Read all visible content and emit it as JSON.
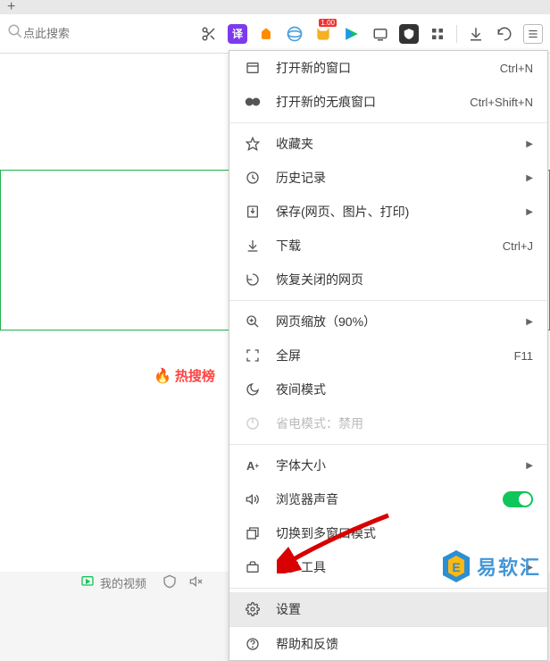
{
  "toolbar": {
    "search_placeholder": "点此搜索",
    "icon_badge": "1.00"
  },
  "page": {
    "hot_search_label": "热搜榜"
  },
  "bottom": {
    "my_video_label": "我的视频"
  },
  "menu": {
    "new_window": {
      "label": "打开新的窗口",
      "shortcut": "Ctrl+N"
    },
    "new_incognito": {
      "label": "打开新的无痕窗口",
      "shortcut": "Ctrl+Shift+N"
    },
    "favorites": {
      "label": "收藏夹"
    },
    "history": {
      "label": "历史记录"
    },
    "save": {
      "label": "保存(网页、图片、打印)"
    },
    "download": {
      "label": "下载",
      "shortcut": "Ctrl+J"
    },
    "restore": {
      "label": "恢复关闭的网页"
    },
    "zoom": {
      "label": "网页缩放（90%）"
    },
    "fullscreen": {
      "label": "全屏",
      "shortcut": "F11"
    },
    "night": {
      "label": "夜间模式"
    },
    "power": {
      "label": "省电模式：禁用"
    },
    "font": {
      "label": "字体大小"
    },
    "sound": {
      "label": "浏览器声音"
    },
    "multiwindow": {
      "label": "切换到多窗口模式"
    },
    "more": {
      "label": "更多工具"
    },
    "settings": {
      "label": "设置"
    },
    "help": {
      "label": "帮助和反馈"
    }
  },
  "watermark": {
    "text": "易软汇"
  }
}
